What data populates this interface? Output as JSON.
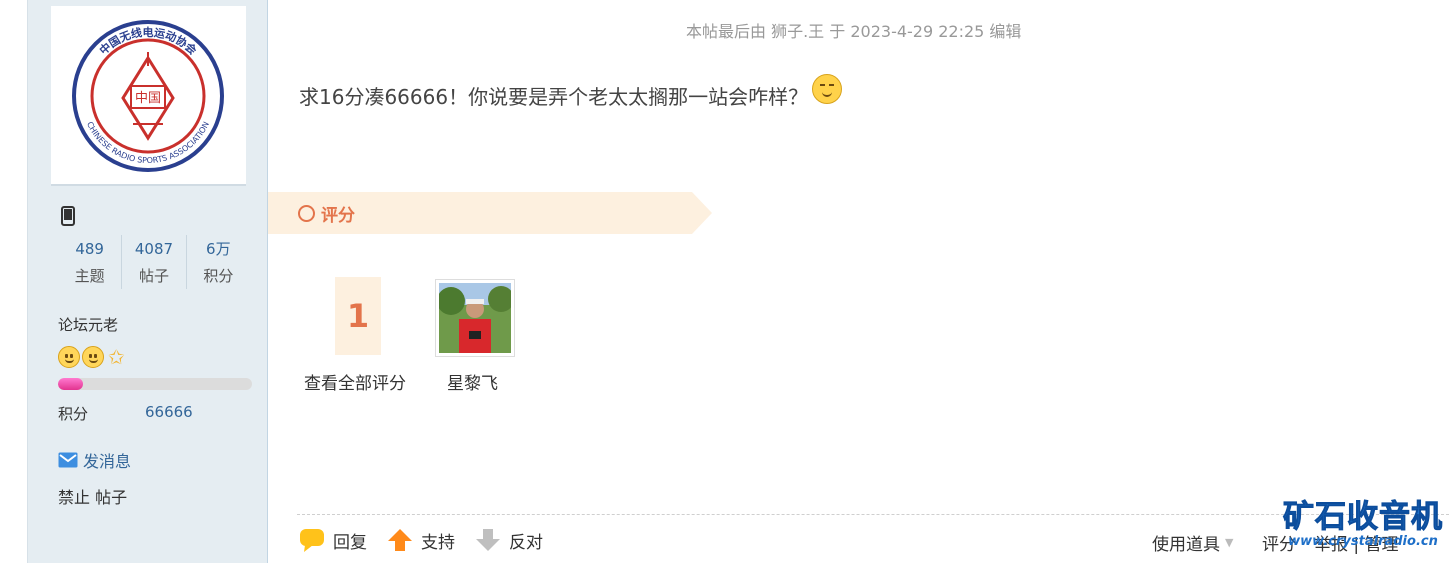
{
  "sidebar": {
    "stats": [
      {
        "value": "489",
        "label": "主题"
      },
      {
        "value": "4087",
        "label": "帖子"
      },
      {
        "value": "6万",
        "label": "积分"
      }
    ],
    "rank": "论坛元老",
    "progress_fraction": 0.13,
    "credit_label": "积分",
    "credit_value": "66666",
    "send_message": "发消息",
    "ban_post": "禁止 帖子",
    "logo": {
      "top_text": "中国无线电运动协会",
      "bottom_text": "CHINESE RADIO SPORTS ASSOCIATION",
      "center_text": "中国"
    }
  },
  "post": {
    "edited_note": "本帖最后由 狮子.王 于 2023-4-29 22:25 编辑",
    "text": "求16分凑66666！你说要是弄个老太太搁那一站会咋样？"
  },
  "rating": {
    "title": "评分",
    "count": "1",
    "view_all": "查看全部评分",
    "raters": [
      {
        "name": "星黎飞"
      }
    ]
  },
  "actions": {
    "reply": "回复",
    "support": "支持",
    "oppose": "反对",
    "use_tools": "使用道具",
    "rate": "评分",
    "more": "举报 | 管理"
  },
  "watermark": {
    "title": "矿石收音机",
    "url": "www.crystalradio.cn"
  },
  "colors": {
    "accent": "#e3744b",
    "link": "#336699",
    "sidebar_bg": "#e5edf2",
    "watermark": "#1e6fc8"
  }
}
